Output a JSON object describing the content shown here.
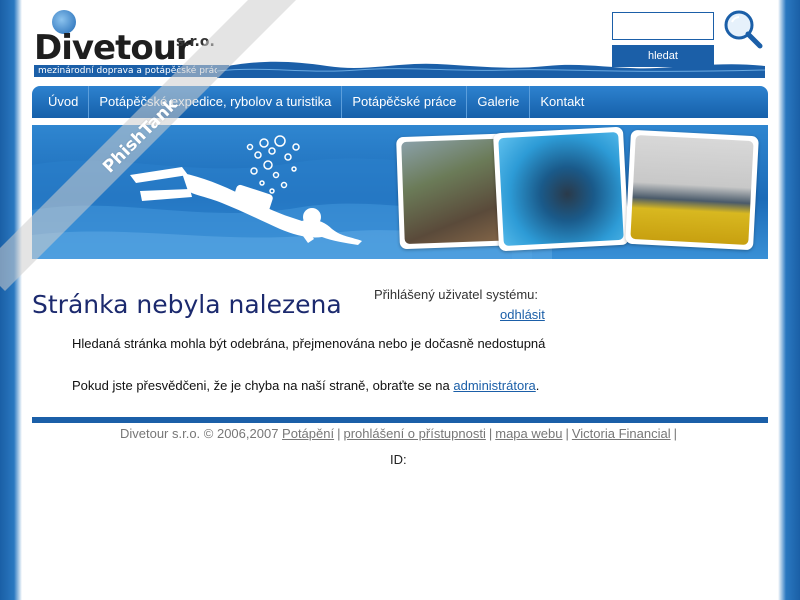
{
  "header": {
    "brand_name": "Divetour",
    "brand_suffix": "s.r.o.",
    "tagline": "mezinárodní doprava a potápěčské práce",
    "search_placeholder": "",
    "search_button": "hledat"
  },
  "nav": {
    "items": [
      {
        "label": "Úvod"
      },
      {
        "label": "Potápěčské expedice, rybolov a turistika"
      },
      {
        "label": "Potápěčské práce"
      },
      {
        "label": "Galerie"
      },
      {
        "label": "Kontakt"
      }
    ]
  },
  "content": {
    "title": "Stránka nebyla nalezena",
    "user_label": "Přihlášený uživatel systému:",
    "logout": "odhlásit",
    "message1": "Hledaná stránka mohla být odebrána, přejmenována nebo je dočasně nedostupná",
    "message2_prefix": "Pokud jste přesvědčeni, že je chyba na naší straně, obraťte se na ",
    "message2_link": "administrátora",
    "message2_suffix": "."
  },
  "footer": {
    "copyright": "Divetour s.r.o. © 2006,2007",
    "links": [
      "Potápění",
      "prohlášení o přístupnosti",
      "mapa webu",
      "Victoria Financial"
    ],
    "id_label": "ID:"
  },
  "watermark": {
    "text": "PhishTank"
  },
  "colors": {
    "brand_blue": "#1b5fa8",
    "title_navy": "#1c2a6e",
    "link_blue": "#1b5fa8"
  }
}
